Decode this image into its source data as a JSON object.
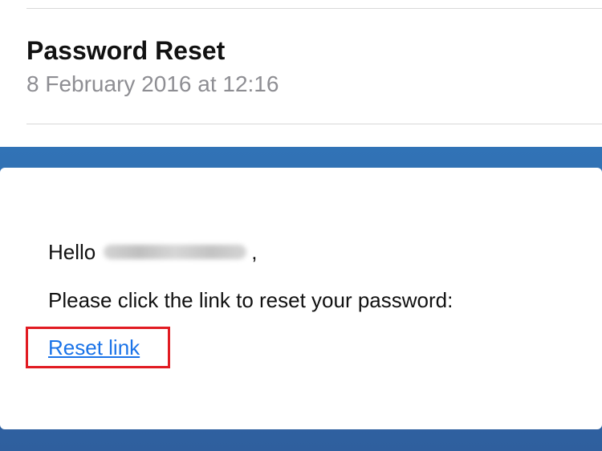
{
  "email": {
    "subject": "Password Reset",
    "date": "8 February 2016 at 12:16",
    "body": {
      "greeting": "Hello",
      "greeting_suffix": ",",
      "message": "Please click the link to reset your password:",
      "link_text": "Reset link"
    }
  },
  "colors": {
    "frame_blue": "#3173b6",
    "link_blue": "#1a73e8",
    "highlight_red": "#e11b22",
    "date_gray": "#8e8e93"
  }
}
